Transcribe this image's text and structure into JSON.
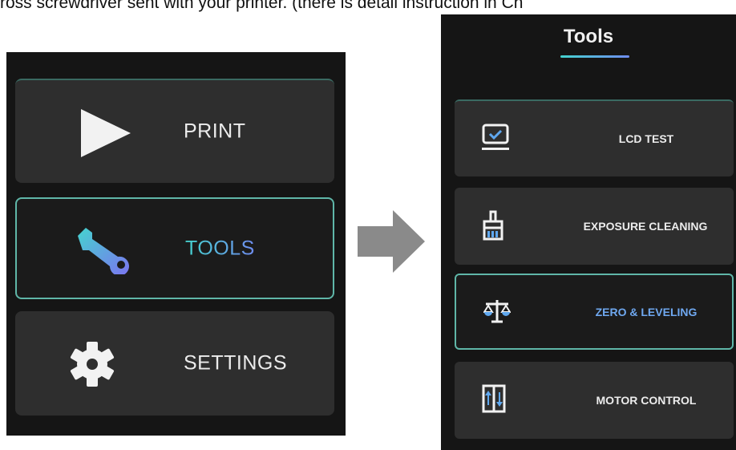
{
  "caption": "ross screwdriver sent with your printer. (there is detail instruction in Ch",
  "left_screen": {
    "menu": [
      {
        "label": "PRINT",
        "icon": "play-icon"
      },
      {
        "label": "TOOLS",
        "icon": "wrench-icon",
        "selected": true
      },
      {
        "label": "SETTINGS",
        "icon": "gear-icon"
      }
    ]
  },
  "right_screen": {
    "title": "Tools",
    "items": [
      {
        "label": "LCD TEST",
        "icon": "lcd-monitor-icon"
      },
      {
        "label": "EXPOSURE CLEANING",
        "icon": "brush-icon"
      },
      {
        "label": "ZERO & LEVELING",
        "icon": "balance-scale-icon",
        "selected": true
      },
      {
        "label": "MOTOR CONTROL",
        "icon": "up-down-arrows-icon"
      }
    ]
  },
  "colors": {
    "screen_bg": "#151515",
    "button_bg": "#2e2e2e",
    "accent_teal": "#45d3cf",
    "accent_blue": "#6f8cf0"
  }
}
